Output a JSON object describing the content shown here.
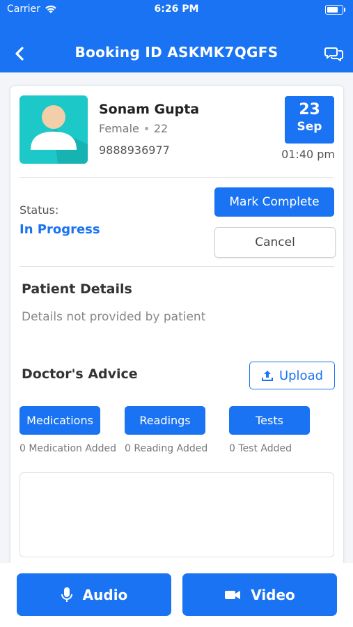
{
  "status_bar": {
    "carrier": "Carrier",
    "time": "6:26 PM"
  },
  "header": {
    "title": "Booking ID ASKMK7QGFS",
    "back_icon": "chevron-left-icon",
    "chat_icon": "chat-bubbles-icon"
  },
  "patient": {
    "name": "Sonam Gupta",
    "gender": "Female",
    "age": "22",
    "phone": "9888936977"
  },
  "appointment": {
    "day": "23",
    "month": "Sep",
    "time": "01:40 pm"
  },
  "status": {
    "label": "Status:",
    "value": "In Progress"
  },
  "actions": {
    "mark_complete": "Mark Complete",
    "cancel": "Cancel"
  },
  "patient_details": {
    "title": "Patient Details",
    "text": "Details not provided by patient"
  },
  "doctors_advice": {
    "title": "Doctor's Advice",
    "upload_label": "Upload",
    "tabs": [
      {
        "label": "Medications",
        "count": "0 Medication Added"
      },
      {
        "label": "Readings",
        "count": "0 Reading Added"
      },
      {
        "label": "Tests",
        "count": "0 Test Added"
      }
    ]
  },
  "call": {
    "audio": "Audio",
    "video": "Video"
  },
  "colors": {
    "primary": "#1a73f2",
    "avatar_bg": "#1cc8c8",
    "avatar_skin": "#f2cfa8"
  }
}
